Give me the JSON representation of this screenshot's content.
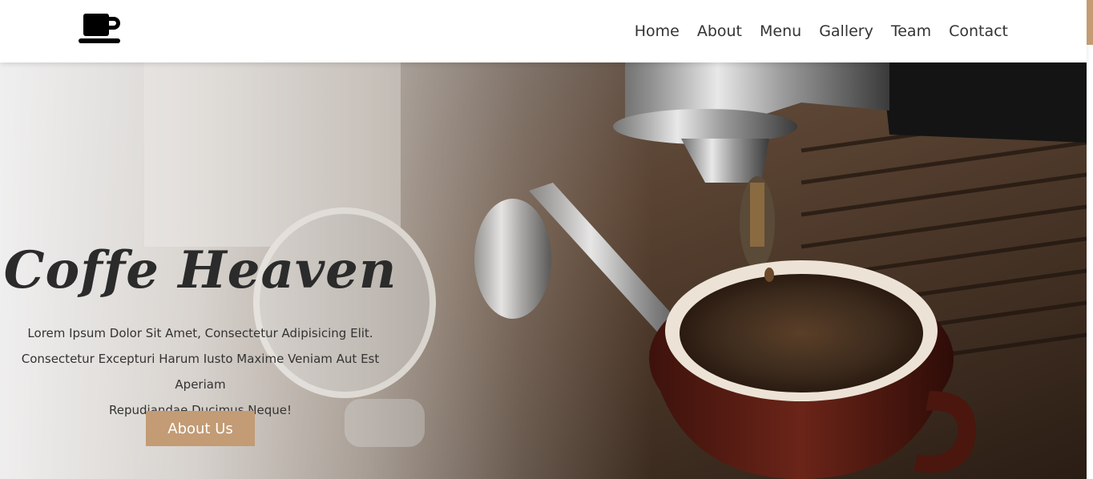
{
  "header": {
    "logo_icon": "coffee-cup-icon",
    "nav": [
      "Home",
      "About",
      "Menu",
      "Gallery",
      "Team",
      "Contact"
    ]
  },
  "hero": {
    "title": "Coffe Heaven",
    "text_lines": [
      "Lorem Ipsum Dolor Sit Amet, Consectetur Adipisicing Elit.",
      "Consectetur Excepturi Harum Iusto Maxime Veniam Aut Est Aperiam",
      "Repudiandae Ducimus Neque!"
    ],
    "button_label": "About Us"
  },
  "colors": {
    "accent": "#c39b74",
    "text_dark": "#2b2b2b",
    "header_bg": "#ffffff"
  }
}
